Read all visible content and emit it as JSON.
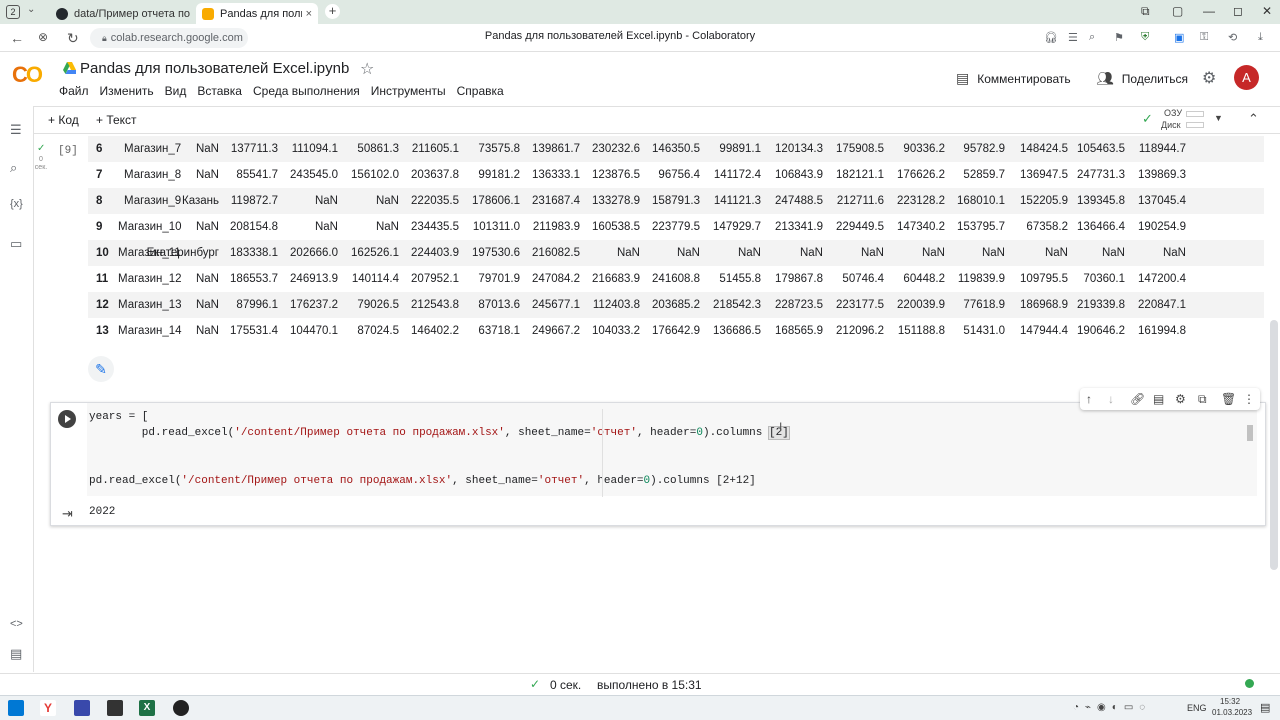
{
  "browser": {
    "tab_count_badge": "2",
    "tabs": [
      {
        "title": "data/Пример отчета по пр",
        "active": false
      },
      {
        "title": "Pandas для пользовател",
        "active": true
      }
    ],
    "url": "colab.research.google.com",
    "page_title": "Pandas для пользователей Excel.ipynb - Colaboratory"
  },
  "colab": {
    "logo": "CO",
    "notebook_title": "Pandas для пользователей Excel.ipynb",
    "menu": [
      "Файл",
      "Изменить",
      "Вид",
      "Вставка",
      "Среда выполнения",
      "Инструменты",
      "Справка"
    ],
    "comment_label": "Комментировать",
    "share_label": "Поделиться",
    "avatar_letter": "A",
    "toolbar": {
      "code_label": "+ Код",
      "text_label": "+ Текст",
      "ram_label": "ОЗУ",
      "disk_label": "Диск"
    },
    "accent": "#f9ab00"
  },
  "output_cell": {
    "exec_count": "[9]",
    "exec_time": "0 сек.",
    "rows": [
      [
        "6",
        "Магазин_7",
        "NaN",
        "137711.3",
        "111094.1",
        "50861.3",
        "211605.1",
        "73575.8",
        "139861.7",
        "230232.6",
        "146350.5",
        "99891.1",
        "120134.3",
        "175908.5",
        "90336.2",
        "95782.9",
        "148424.5",
        "105463.5",
        "118944.7"
      ],
      [
        "7",
        "Магазин_8",
        "NaN",
        "85541.7",
        "243545.0",
        "156102.0",
        "203637.8",
        "99181.2",
        "136333.1",
        "123876.5",
        "96756.4",
        "141172.4",
        "106843.9",
        "182121.1",
        "176626.2",
        "52859.7",
        "136947.5",
        "247731.3",
        "139869.3"
      ],
      [
        "8",
        "Магазин_9",
        "Казань",
        "119872.7",
        "NaN",
        "NaN",
        "222035.5",
        "178606.1",
        "231687.4",
        "133278.9",
        "158791.3",
        "141121.3",
        "247488.5",
        "212711.6",
        "223128.2",
        "168010.1",
        "152205.9",
        "139345.8",
        "137045.4"
      ],
      [
        "9",
        "Магазин_10",
        "NaN",
        "208154.8",
        "NaN",
        "NaN",
        "234435.5",
        "101311.0",
        "211983.9",
        "160538.5",
        "223779.5",
        "147929.7",
        "213341.9",
        "229449.5",
        "147340.2",
        "153795.7",
        "67358.2",
        "136466.4",
        "190254.9"
      ],
      [
        "10",
        "Магазин_11",
        "Екатеринбург",
        "183338.1",
        "202666.0",
        "162526.1",
        "224403.9",
        "197530.6",
        "216082.5",
        "NaN",
        "NaN",
        "NaN",
        "NaN",
        "NaN",
        "NaN",
        "NaN",
        "NaN",
        "NaN",
        "NaN"
      ],
      [
        "11",
        "Магазин_12",
        "NaN",
        "186553.7",
        "246913.9",
        "140114.4",
        "207952.1",
        "79701.9",
        "247084.2",
        "216683.9",
        "241608.8",
        "51455.8",
        "179867.8",
        "50746.4",
        "60448.2",
        "119839.9",
        "109795.5",
        "70360.1",
        "147200.4"
      ],
      [
        "12",
        "Магазин_13",
        "NaN",
        "87996.1",
        "176237.2",
        "79026.5",
        "212543.8",
        "87013.6",
        "245677.1",
        "112403.8",
        "203685.2",
        "218542.3",
        "228723.5",
        "223177.5",
        "220039.9",
        "77618.9",
        "186968.9",
        "219339.8",
        "220847.1"
      ],
      [
        "13",
        "Магазин_14",
        "NaN",
        "175531.4",
        "104470.1",
        "87024.5",
        "146402.2",
        "63718.1",
        "249667.2",
        "104033.2",
        "176642.9",
        "136686.5",
        "168565.9",
        "212096.2",
        "151188.8",
        "51431.0",
        "147944.4",
        "190646.2",
        "161994.8"
      ]
    ]
  },
  "code_cell": {
    "line1": "years = [",
    "line2_a": "        pd.read_excel(",
    "line2_str1": "'/content/Пример отчета по продажам.xlsx'",
    "line2_b": ", sheet_name=",
    "line2_str2": "'отчет'",
    "line2_c": ", header=",
    "line2_num": "0",
    "line2_d": ").columns ",
    "line2_e": "[2]",
    "line3_a": "pd.read_excel(",
    "line3_str1": "'/content/Пример отчета по продажам.xlsx'",
    "line3_b": ", sheet_name=",
    "line3_str2": "'отчет'",
    "line3_c": ", header=",
    "line3_num": "0",
    "line3_d": ").columns ",
    "line3_e": "[2+12]",
    "output": "2022"
  },
  "status": {
    "time": "0 сек.",
    "completed": "выполнено в 15:31"
  },
  "taskbar": {
    "lang": "ENG",
    "clock_time": "15:32",
    "clock_date": "01.03.2023"
  }
}
